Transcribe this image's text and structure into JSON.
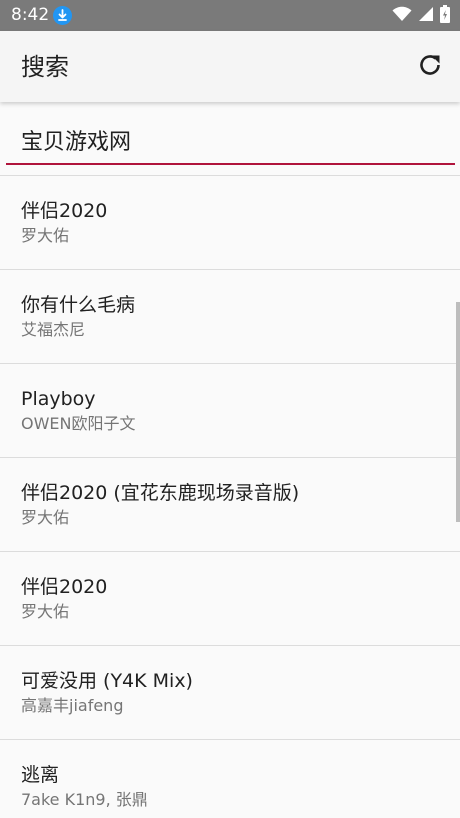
{
  "status_bar": {
    "time": "8:42",
    "icons": [
      "download-icon",
      "wifi-icon",
      "signal-icon",
      "battery-icon"
    ]
  },
  "app_bar": {
    "title": "搜索",
    "refresh_icon": "refresh-icon"
  },
  "search": {
    "value": "宝贝游戏网",
    "placeholder": ""
  },
  "results": [
    {
      "title": "伴侣2020",
      "artist": "罗大佑"
    },
    {
      "title": "你有什么毛病",
      "artist": "艾福杰尼"
    },
    {
      "title": "Playboy",
      "artist": "OWEN欧阳子文"
    },
    {
      "title": "伴侣2020 (宜花东鹿现场录音版)",
      "artist": "罗大佑"
    },
    {
      "title": "伴侣2020",
      "artist": "罗大佑"
    },
    {
      "title": "可爱没用 (Y4K Mix)",
      "artist": "高嘉丰jiafeng"
    },
    {
      "title": "逃离",
      "artist": "7ake K1n9, 张鼎"
    }
  ],
  "colors": {
    "accent": "#b0143c",
    "status_bar": "#7a7a7a",
    "download_badge": "#2196f3"
  }
}
